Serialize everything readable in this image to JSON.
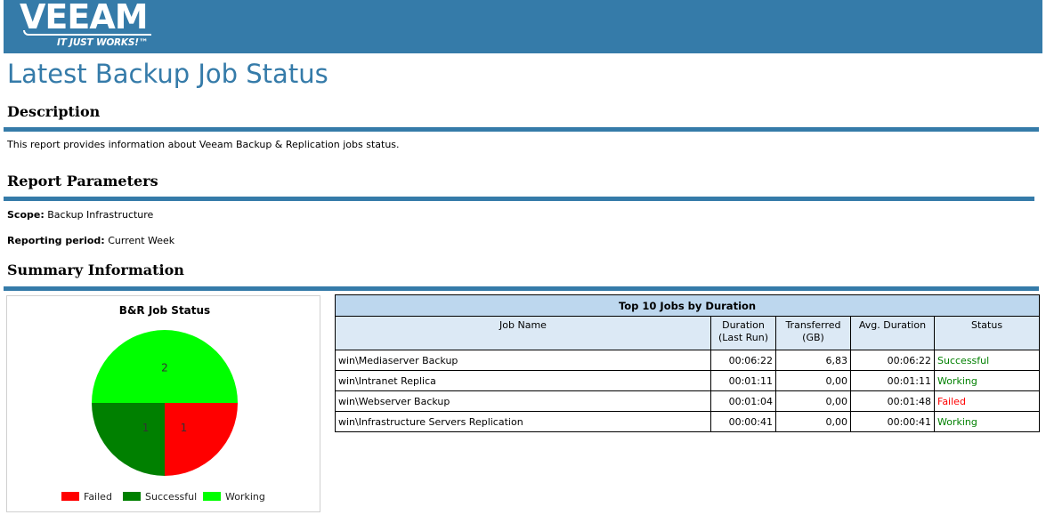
{
  "brand": {
    "logo_word": "VEEAM",
    "logo_tagline": "IT JUST WORKS!™",
    "banner_color": "#357ba9"
  },
  "report": {
    "title": "Latest Backup Job Status",
    "description_heading": "Description",
    "description_text": "This report provides information about Veeam Backup & Replication jobs status.",
    "parameters_heading": "Report Parameters",
    "scope_label": "Scope:",
    "scope_value": "Backup Infrastructure",
    "period_label": "Reporting period:",
    "period_value": "Current Week",
    "summary_heading": "Summary Information"
  },
  "chart_data": {
    "type": "pie",
    "title": "B&R Job Status",
    "categories": [
      "Failed",
      "Successful",
      "Working"
    ],
    "values": [
      1,
      1,
      2
    ],
    "colors": [
      "#ff0000",
      "#008000",
      "#00ff00"
    ],
    "legend_placement": "bottom"
  },
  "jobs_table": {
    "caption": "Top 10 Jobs by Duration",
    "columns": [
      "Job Name",
      "Duration (Last Run)",
      "Transferred (GB)",
      "Avg. Duration",
      "Status"
    ],
    "rows": [
      {
        "job": "win\\Mediaserver Backup",
        "duration": "00:06:22",
        "transferred": "6,83",
        "avg": "00:06:22",
        "status": "Successful"
      },
      {
        "job": "win\\Intranet Replica",
        "duration": "00:01:11",
        "transferred": "0,00",
        "avg": "00:01:11",
        "status": "Working"
      },
      {
        "job": "win\\Webserver Backup",
        "duration": "00:01:04",
        "transferred": "0,00",
        "avg": "00:01:48",
        "status": "Failed"
      },
      {
        "job": "win\\Infrastructure Servers Replication",
        "duration": "00:00:41",
        "transferred": "0,00",
        "avg": "00:00:41",
        "status": "Working"
      }
    ]
  }
}
